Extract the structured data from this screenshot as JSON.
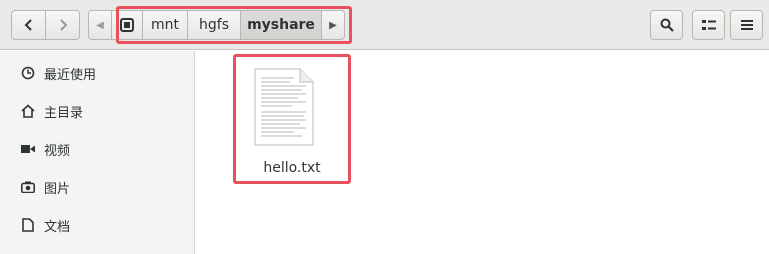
{
  "toolbar": {
    "back_icon": "chevron-left-icon",
    "forward_icon": "chevron-right-icon",
    "search_icon": "search-icon",
    "view_icon": "list-view-icon",
    "menu_icon": "hamburger-menu-icon"
  },
  "path_bar": {
    "segments": [
      "mnt",
      "hgfs",
      "myshare"
    ],
    "current": "myshare"
  },
  "sidebar": {
    "items": [
      {
        "label": "最近使用",
        "icon": "clock-icon"
      },
      {
        "label": "主目录",
        "icon": "home-icon"
      },
      {
        "label": "视频",
        "icon": "video-icon"
      },
      {
        "label": "图片",
        "icon": "camera-icon"
      },
      {
        "label": "文档",
        "icon": "document-icon"
      }
    ]
  },
  "files": [
    {
      "name": "hello.txt",
      "icon": "text-file-icon",
      "selected": true
    }
  ],
  "colors": {
    "highlight_box": "#e8505b",
    "header_bg": "#e9e9e7",
    "sidebar_bg": "#f4f4f3"
  }
}
